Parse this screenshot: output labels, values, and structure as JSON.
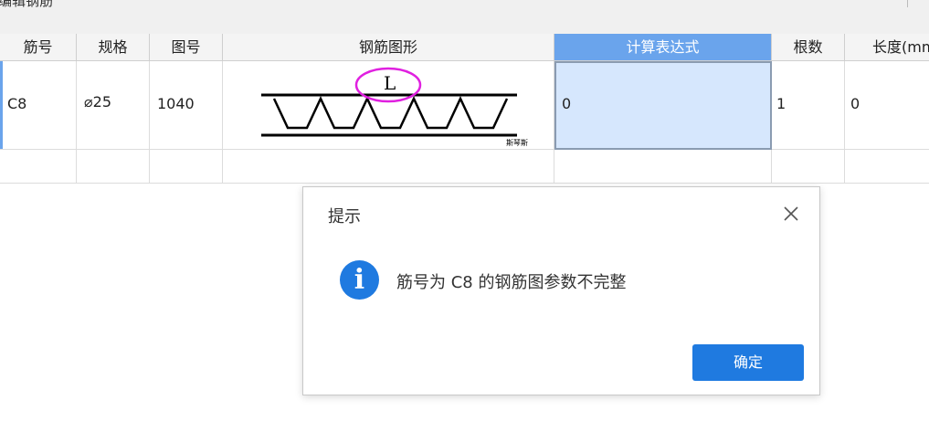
{
  "window": {
    "title": "编辑钢筋"
  },
  "table": {
    "columns": [
      "筋号",
      "规格",
      "图号",
      "钢筋图形",
      "计算表达式",
      "根数",
      "长度(mm)"
    ],
    "rows": [
      {
        "bar_no": "C8",
        "spec": "⌀25",
        "figure_no": "1040",
        "shape_label_L": "L",
        "shape_caption": "斯琴斯",
        "expression": "0",
        "count": "1",
        "length": "0"
      }
    ]
  },
  "dialog": {
    "title": "提示",
    "message": "筋号为 C8 的钢筋图参数不完整",
    "ok_label": "确定",
    "info_glyph": "i",
    "close_glyph": "×"
  },
  "colors": {
    "accent": "#1f7ae0",
    "header_active": "#6aa4ec",
    "cell_selected": "#d6e7fd",
    "annotation": "#e020e0"
  }
}
